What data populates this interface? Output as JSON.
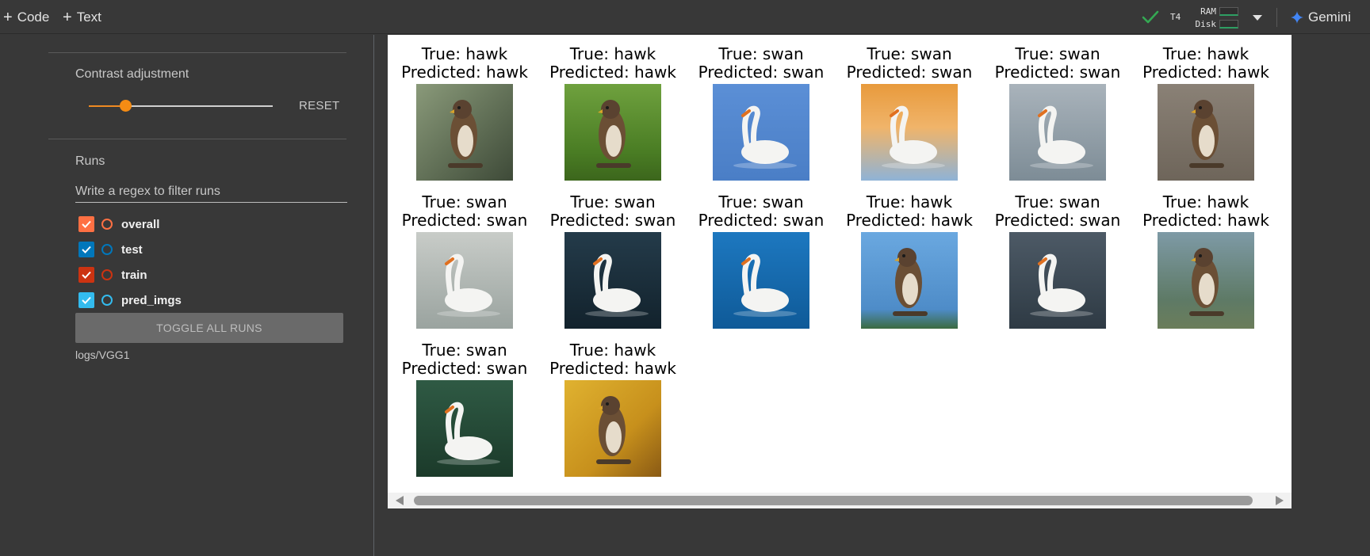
{
  "toolbar": {
    "code_label": "Code",
    "text_label": "Text",
    "runtime_status": "connected",
    "gpu": "T4",
    "ram_label": "RAM",
    "disk_label": "Disk",
    "gemini_label": "Gemini",
    "colors": {
      "check": "#34a853",
      "gemini_star": "#4285f4",
      "resource_bar": "#2e9e62"
    }
  },
  "sidebar": {
    "contrast_label": "Contrast adjustment",
    "contrast_value": 0.2,
    "reset_label": "RESET",
    "runs_label": "Runs",
    "filter_placeholder": "Write a regex to filter runs",
    "runs": [
      {
        "name": "overall",
        "checked": true,
        "color": "#ff7043"
      },
      {
        "name": "test",
        "checked": true,
        "color": "#0077bb"
      },
      {
        "name": "train",
        "checked": true,
        "color": "#cc3311"
      },
      {
        "name": "pred_imgs",
        "checked": true,
        "color": "#33bbee"
      }
    ],
    "toggle_all_label": "TOGGLE ALL RUNS",
    "log_dir": "logs/VGG1"
  },
  "predictions": [
    {
      "true_label": "True: hawk",
      "predicted_label": "Predicted: hawk",
      "subject": "hawk"
    },
    {
      "true_label": "True: hawk",
      "predicted_label": "Predicted: hawk",
      "subject": "hawk"
    },
    {
      "true_label": "True: swan",
      "predicted_label": "Predicted: swan",
      "subject": "swan"
    },
    {
      "true_label": "True: swan",
      "predicted_label": "Predicted: swan",
      "subject": "swan"
    },
    {
      "true_label": "True: swan",
      "predicted_label": "Predicted: swan",
      "subject": "swan"
    },
    {
      "true_label": "True: hawk",
      "predicted_label": "Predicted: hawk",
      "subject": "hawk"
    },
    {
      "true_label": "True: swan",
      "predicted_label": "Predicted: swan",
      "subject": "swan"
    },
    {
      "true_label": "True: swan",
      "predicted_label": "Predicted: swan",
      "subject": "swan"
    },
    {
      "true_label": "True: swan",
      "predicted_label": "Predicted: swan",
      "subject": "swan"
    },
    {
      "true_label": "True: hawk",
      "predicted_label": "Predicted: hawk",
      "subject": "hawk"
    },
    {
      "true_label": "True: swan",
      "predicted_label": "Predicted: swan",
      "subject": "swan"
    },
    {
      "true_label": "True: hawk",
      "predicted_label": "Predicted: hawk",
      "subject": "hawk"
    },
    {
      "true_label": "True: swan",
      "predicted_label": "Predicted: swan",
      "subject": "swan"
    },
    {
      "true_label": "True: hawk",
      "predicted_label": "Predicted: hawk",
      "subject": "hawk"
    }
  ]
}
